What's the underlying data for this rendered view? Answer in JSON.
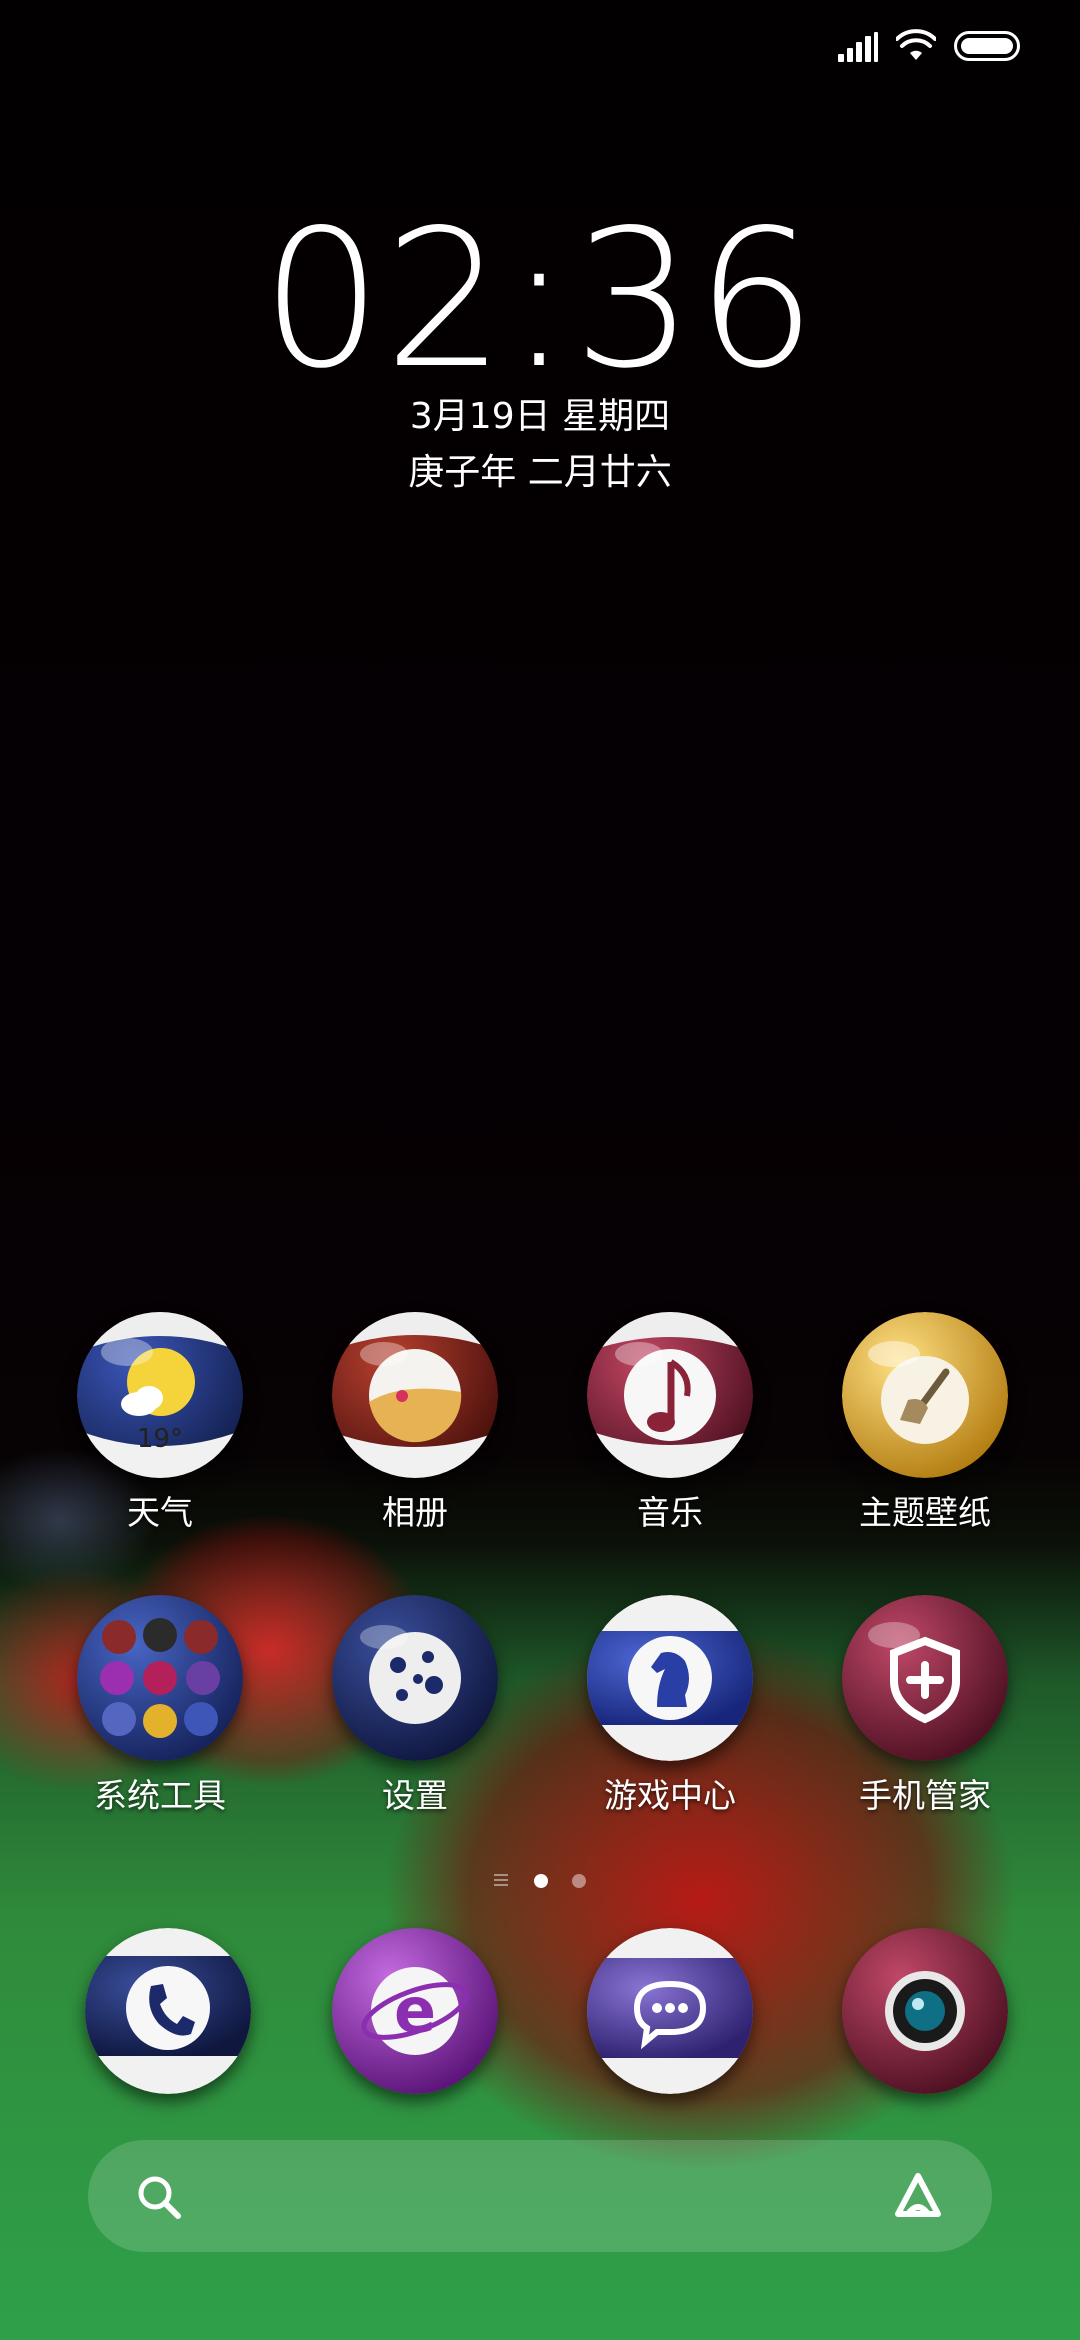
{
  "status_bar": {
    "signal_icon": "signal-bars-icon",
    "wifi_icon": "wifi-icon",
    "battery_icon": "battery-full-icon"
  },
  "lock": {
    "time": "02:36",
    "date": "3月19日 星期四",
    "lunar_date": "庚子年 二月廿六"
  },
  "apps_row1": [
    {
      "label": "天气",
      "icon": "weather-icon",
      "temp": "19°"
    },
    {
      "label": "相册",
      "icon": "gallery-icon"
    },
    {
      "label": "音乐",
      "icon": "music-note-icon"
    },
    {
      "label": "主题壁纸",
      "icon": "brush-icon"
    }
  ],
  "apps_row2": [
    {
      "label": "系统工具",
      "icon": "folder-grid-icon"
    },
    {
      "label": "设置",
      "icon": "gear-icon"
    },
    {
      "label": "游戏中心",
      "icon": "chess-knight-icon"
    },
    {
      "label": "手机管家",
      "icon": "shield-plus-icon"
    }
  ],
  "dock": [
    {
      "icon": "phone-icon"
    },
    {
      "icon": "browser-e-icon"
    },
    {
      "icon": "message-bubble-icon"
    },
    {
      "icon": "camera-lens-icon"
    }
  ],
  "pager": {
    "pages": 2,
    "current": 1
  },
  "search": {
    "search_icon": "search-icon",
    "assistant_icon": "assistant-a-icon"
  },
  "colors": {
    "weather_ball": "#1e2e6e",
    "gallery_ball": "#7a1f1a",
    "music_ball": "#8a2338",
    "theme_ball": "#e3b12b",
    "settings_ball": "#1c2a6b",
    "game_ball": "#2a3fa6",
    "security_ball": "#8b2440",
    "browser_ball": "#8b2fb0",
    "message_ball": "#5e4aa8",
    "camera_ball": "#8b2440",
    "table_green": "#2fa04a"
  }
}
